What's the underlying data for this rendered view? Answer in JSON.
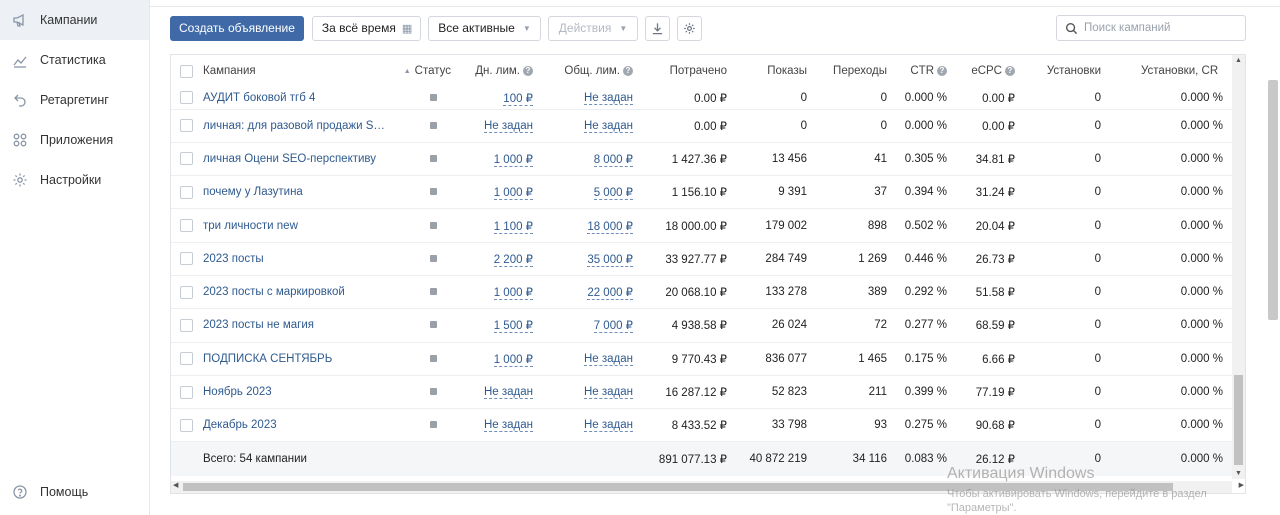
{
  "sidebar": {
    "items": [
      {
        "label": "Кампании",
        "icon": "megaphone-icon",
        "active": true
      },
      {
        "label": "Статистика",
        "icon": "chart-line-icon"
      },
      {
        "label": "Ретаргетинг",
        "icon": "retarget-arrow-icon"
      },
      {
        "label": "Приложения",
        "icon": "apps-grid-icon"
      },
      {
        "label": "Настройки",
        "icon": "gear-icon"
      }
    ],
    "help_label": "Помощь"
  },
  "toolbar": {
    "create_label": "Создать объявление",
    "period_label": "За всё время",
    "filter_label": "Все активные",
    "actions_label": "Действия",
    "search_placeholder": "Поиск кампаний"
  },
  "table": {
    "columns": [
      "Кампания",
      "Статус",
      "Дн. лим.",
      "Общ. лим.",
      "Потрачено",
      "Показы",
      "Переходы",
      "CTR",
      "eCPC",
      "Установки",
      "Установки, CR"
    ],
    "rows": [
      {
        "name": "АУДИТ боковой тгб 4",
        "day": "100 ₽",
        "total": "Не задан",
        "spent": "0.00 ₽",
        "shows": "0",
        "clicks": "0",
        "ctr": "0.000 %",
        "ecpc": "0.00 ₽",
        "inst": "0",
        "cr": "0.000 %"
      },
      {
        "name": "личная: для разовой продажи SEO ...",
        "day": "Не задан",
        "total": "Не задан",
        "spent": "0.00 ₽",
        "shows": "0",
        "clicks": "0",
        "ctr": "0.000 %",
        "ecpc": "0.00 ₽",
        "inst": "0",
        "cr": "0.000 %"
      },
      {
        "name": "личная Оцени SEO-перспективу",
        "day": "1 000 ₽",
        "total": "8 000 ₽",
        "spent": "1 427.36 ₽",
        "shows": "13 456",
        "clicks": "41",
        "ctr": "0.305 %",
        "ecpc": "34.81 ₽",
        "inst": "0",
        "cr": "0.000 %"
      },
      {
        "name": "почему у Лазутина",
        "day": "1 000 ₽",
        "total": "5 000 ₽",
        "spent": "1 156.10 ₽",
        "shows": "9 391",
        "clicks": "37",
        "ctr": "0.394 %",
        "ecpc": "31.24 ₽",
        "inst": "0",
        "cr": "0.000 %"
      },
      {
        "name": "три личности new",
        "day": "1 100 ₽",
        "total": "18 000 ₽",
        "spent": "18 000.00 ₽",
        "shows": "179 002",
        "clicks": "898",
        "ctr": "0.502 %",
        "ecpc": "20.04 ₽",
        "inst": "0",
        "cr": "0.000 %"
      },
      {
        "name": "2023 посты",
        "day": "2 200 ₽",
        "total": "35 000 ₽",
        "spent": "33 927.77 ₽",
        "shows": "284 749",
        "clicks": "1 269",
        "ctr": "0.446 %",
        "ecpc": "26.73 ₽",
        "inst": "0",
        "cr": "0.000 %"
      },
      {
        "name": "2023 посты с маркировкой",
        "day": "1 000 ₽",
        "total": "22 000 ₽",
        "spent": "20 068.10 ₽",
        "shows": "133 278",
        "clicks": "389",
        "ctr": "0.292 %",
        "ecpc": "51.58 ₽",
        "inst": "0",
        "cr": "0.000 %"
      },
      {
        "name": "2023 посты не магия",
        "day": "1 500 ₽",
        "total": "7 000 ₽",
        "spent": "4 938.58 ₽",
        "shows": "26 024",
        "clicks": "72",
        "ctr": "0.277 %",
        "ecpc": "68.59 ₽",
        "inst": "0",
        "cr": "0.000 %"
      },
      {
        "name": "ПОДПИСКА СЕНТЯБРЬ",
        "day": "1 000 ₽",
        "total": "Не задан",
        "spent": "9 770.43 ₽",
        "shows": "836 077",
        "clicks": "1 465",
        "ctr": "0.175 %",
        "ecpc": "6.66 ₽",
        "inst": "0",
        "cr": "0.000 %"
      },
      {
        "name": "Ноябрь 2023",
        "day": "Не задан",
        "total": "Не задан",
        "spent": "16 287.12 ₽",
        "shows": "52 823",
        "clicks": "211",
        "ctr": "0.399 %",
        "ecpc": "77.19 ₽",
        "inst": "0",
        "cr": "0.000 %"
      },
      {
        "name": "Декабрь 2023",
        "day": "Не задан",
        "total": "Не задан",
        "spent": "8 433.52 ₽",
        "shows": "33 798",
        "clicks": "93",
        "ctr": "0.275 %",
        "ecpc": "90.68 ₽",
        "inst": "0",
        "cr": "0.000 %"
      }
    ],
    "footer": {
      "label": "Всего: 54 кампании",
      "spent": "891 077.13 ₽",
      "shows": "40 872 219",
      "clicks": "34 116",
      "ctr": "0.083 %",
      "ecpc": "26.12 ₽",
      "inst": "0",
      "cr": "0.000 %"
    }
  },
  "watermark": {
    "title": "Активация Windows",
    "line1": "Чтобы активировать Windows, перейдите в раздел",
    "line2": "\"Параметры\"."
  },
  "colors": {
    "accent": "#3f6aa7",
    "link": "#2f5a8f",
    "sidebar_active": "#edf0f4"
  }
}
